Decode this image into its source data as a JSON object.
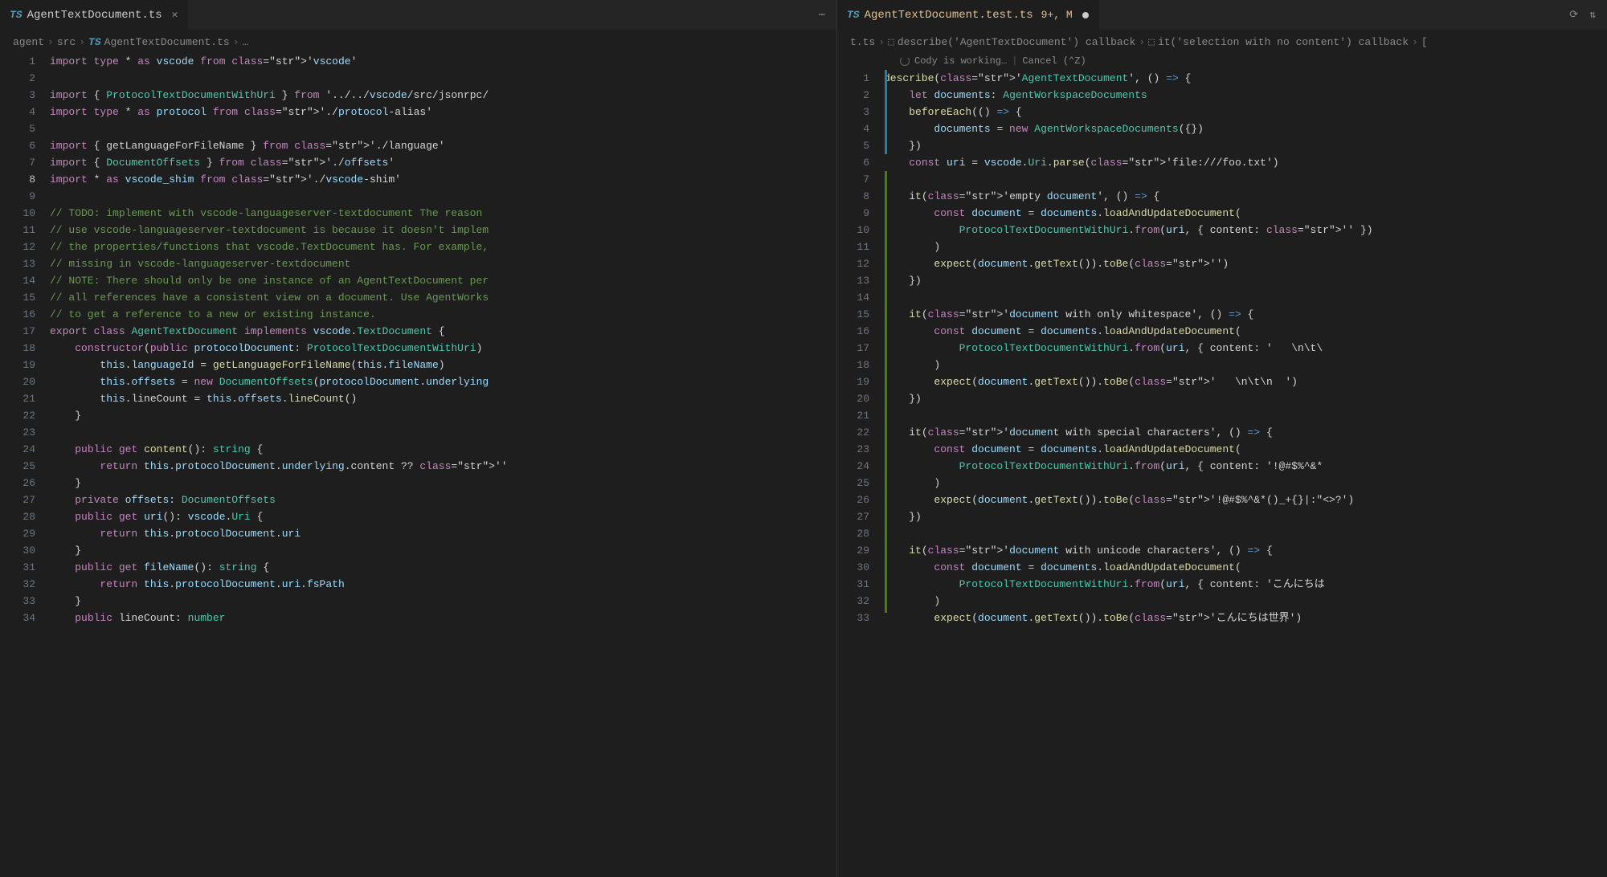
{
  "left": {
    "tab": {
      "icon": "TS",
      "name": "AgentTextDocument.ts"
    },
    "actions_ellipsis": "⋯",
    "breadcrumb": [
      "agent",
      "src",
      "AgentTextDocument.ts",
      "…"
    ],
    "current_line": 8,
    "lines": [
      "import type * as vscode from 'vscode'",
      "",
      "import { ProtocolTextDocumentWithUri } from '../../vscode/src/jsonrpc/",
      "import type * as protocol from './protocol-alias'",
      "",
      "import { getLanguageForFileName } from './language'",
      "import { DocumentOffsets } from './offsets'",
      "import * as vscode_shim from './vscode-shim'",
      "",
      "// TODO: implement with vscode-languageserver-textdocument The reason",
      "// use vscode-languageserver-textdocument is because it doesn't implem",
      "// the properties/functions that vscode.TextDocument has. For example,",
      "// missing in vscode-languageserver-textdocument",
      "// NOTE: There should only be one instance of an AgentTextDocument per",
      "// all references have a consistent view on a document. Use AgentWorks",
      "// to get a reference to a new or existing instance.",
      "export class AgentTextDocument implements vscode.TextDocument {",
      "    constructor(public protocolDocument: ProtocolTextDocumentWithUri)",
      "        this.languageId = getLanguageForFileName(this.fileName)",
      "        this.offsets = new DocumentOffsets(protocolDocument.underlying",
      "        this.lineCount = this.offsets.lineCount()",
      "    }",
      "",
      "    public get content(): string {",
      "        return this.protocolDocument.underlying.content ?? ''",
      "    }",
      "    private offsets: DocumentOffsets",
      "    public get uri(): vscode.Uri {",
      "        return this.protocolDocument.uri",
      "    }",
      "    public get fileName(): string {",
      "        return this.protocolDocument.uri.fsPath",
      "    }",
      "    public lineCount: number"
    ]
  },
  "right": {
    "tab": {
      "icon": "TS",
      "name": "AgentTextDocument.test.ts",
      "badge": "9+, M"
    },
    "breadcrumb_suffix_1": "t.ts",
    "breadcrumb_item_1": "describe('AgentTextDocument') callback",
    "breadcrumb_item_2": "it('selection with no content') callback",
    "cody": {
      "working": "Cody is working…",
      "cancel": "Cancel (⌃Z)"
    },
    "start_line": 1,
    "lines": [
      "describe('AgentTextDocument', () => {",
      "    let documents: AgentWorkspaceDocuments",
      "    beforeEach(() => {",
      "        documents = new AgentWorkspaceDocuments({})",
      "    })",
      "    const uri = vscode.Uri.parse('file:///foo.txt')",
      "",
      "    it('empty document', () => {",
      "        const document = documents.loadAndUpdateDocument(",
      "            ProtocolTextDocumentWithUri.from(uri, { content: '' })",
      "        )",
      "        expect(document.getText()).toBe('')",
      "    })",
      "",
      "    it('document with only whitespace', () => {",
      "        const document = documents.loadAndUpdateDocument(",
      "            ProtocolTextDocumentWithUri.from(uri, { content: '   \\n\\t\\",
      "        )",
      "        expect(document.getText()).toBe('   \\n\\t\\n  ')",
      "    })",
      "",
      "    it('document with special characters', () => {",
      "        const document = documents.loadAndUpdateDocument(",
      "            ProtocolTextDocumentWithUri.from(uri, { content: '!@#$%^&*",
      "        )",
      "        expect(document.getText()).toBe('!@#$%^&*()_+{}|:\"<>?')",
      "    })",
      "",
      "    it('document with unicode characters', () => {",
      "        const document = documents.loadAndUpdateDocument(",
      "            ProtocolTextDocumentWithUri.from(uri, { content: 'こんにちは",
      "        )",
      "        expect(document.getText()).toBe('こんにちは世界')"
    ]
  }
}
